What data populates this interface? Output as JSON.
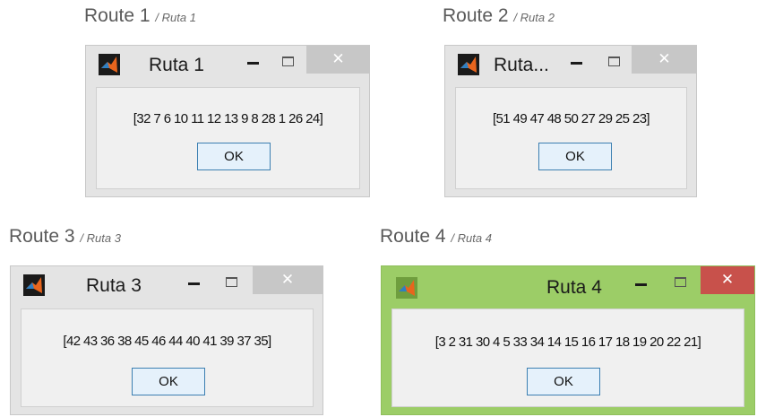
{
  "dialogs": [
    {
      "caption": "Route 1",
      "caption_sub": "/ Ruta 1",
      "title": "Ruta 1",
      "message": "[32 7 6 10 11 12 13 9 8 28 1 26 24]",
      "ok_label": "OK",
      "minimize": "–",
      "close": "✕"
    },
    {
      "caption": "Route 2",
      "caption_sub": "/ Ruta 2",
      "title": "Ruta...",
      "message": "[51 49 47 48 50 27 29 25 23]",
      "ok_label": "OK",
      "minimize": "–",
      "close": "✕"
    },
    {
      "caption": "Route 3",
      "caption_sub": "/ Ruta 3",
      "title": "Ruta 3",
      "message": "[42 43 36 38 45 46 44 40 41 39 37 35]",
      "ok_label": "OK",
      "minimize": "–",
      "close": "✕"
    },
    {
      "caption": "Route 4",
      "caption_sub": "/ Ruta 4",
      "title": "Ruta 4",
      "message": "[3 2 31 30 4 5 33 34 14 15 16 17 18 19 20 22 21]",
      "ok_label": "OK",
      "minimize": "–",
      "close": "✕",
      "active": true
    }
  ],
  "colors": {
    "inactive_frame": "#e4e4e4",
    "active_frame": "#9ccd67",
    "close_inactive": "#c7c7c7",
    "close_active": "#c8514b",
    "ok_border": "#3c7fb1"
  },
  "icons": [
    "matlab-icon",
    "minimize-icon",
    "maximize-icon",
    "close-icon"
  ]
}
